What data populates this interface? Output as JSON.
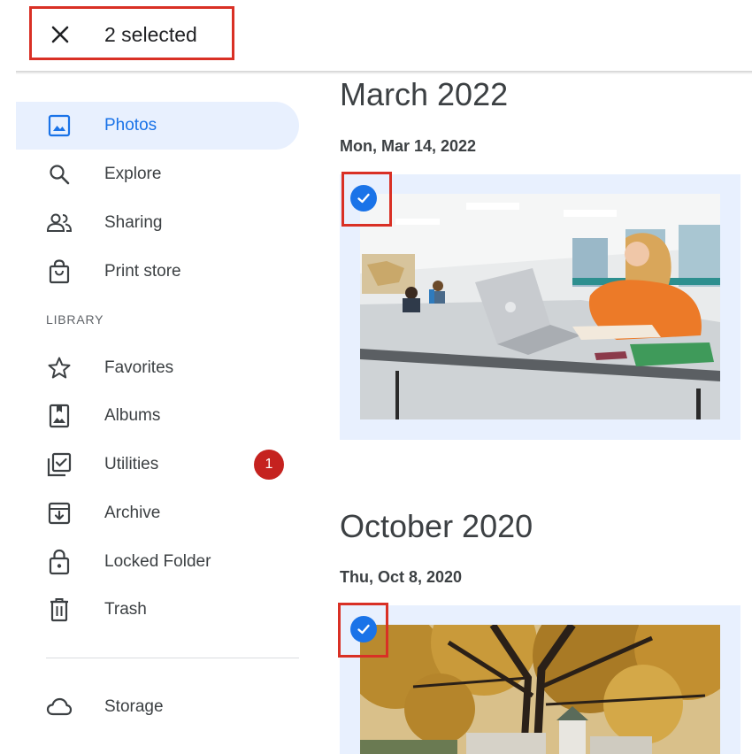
{
  "topbar": {
    "selected_text": "2 selected",
    "close_icon": "close-icon"
  },
  "sidebar": {
    "items": [
      {
        "label": "Photos",
        "icon": "photos-icon",
        "active": true
      },
      {
        "label": "Explore",
        "icon": "search-icon"
      },
      {
        "label": "Sharing",
        "icon": "people-icon"
      },
      {
        "label": "Print store",
        "icon": "shopping-bag-icon"
      }
    ],
    "library_label": "LIBRARY",
    "library_items": [
      {
        "label": "Favorites",
        "icon": "star-icon"
      },
      {
        "label": "Albums",
        "icon": "album-icon"
      },
      {
        "label": "Utilities",
        "icon": "utilities-icon",
        "badge": "1"
      },
      {
        "label": "Archive",
        "icon": "archive-icon"
      },
      {
        "label": "Locked Folder",
        "icon": "lock-icon"
      },
      {
        "label": "Trash",
        "icon": "trash-icon"
      }
    ],
    "storage_label": "Storage",
    "storage_icon": "cloud-icon"
  },
  "groups": [
    {
      "month": "March 2022",
      "date": "Mon, Mar 14, 2022",
      "photo": "classroom-photo",
      "selected": true
    },
    {
      "month": "October 2020",
      "date": "Thu, Oct 8, 2020",
      "photo": "autumn-tree-photo",
      "selected": true
    }
  ],
  "colors": {
    "accent": "#1a73e8",
    "active_bg": "#e8f0fe",
    "highlight_red": "#d93025",
    "badge_red": "#c5221f"
  }
}
